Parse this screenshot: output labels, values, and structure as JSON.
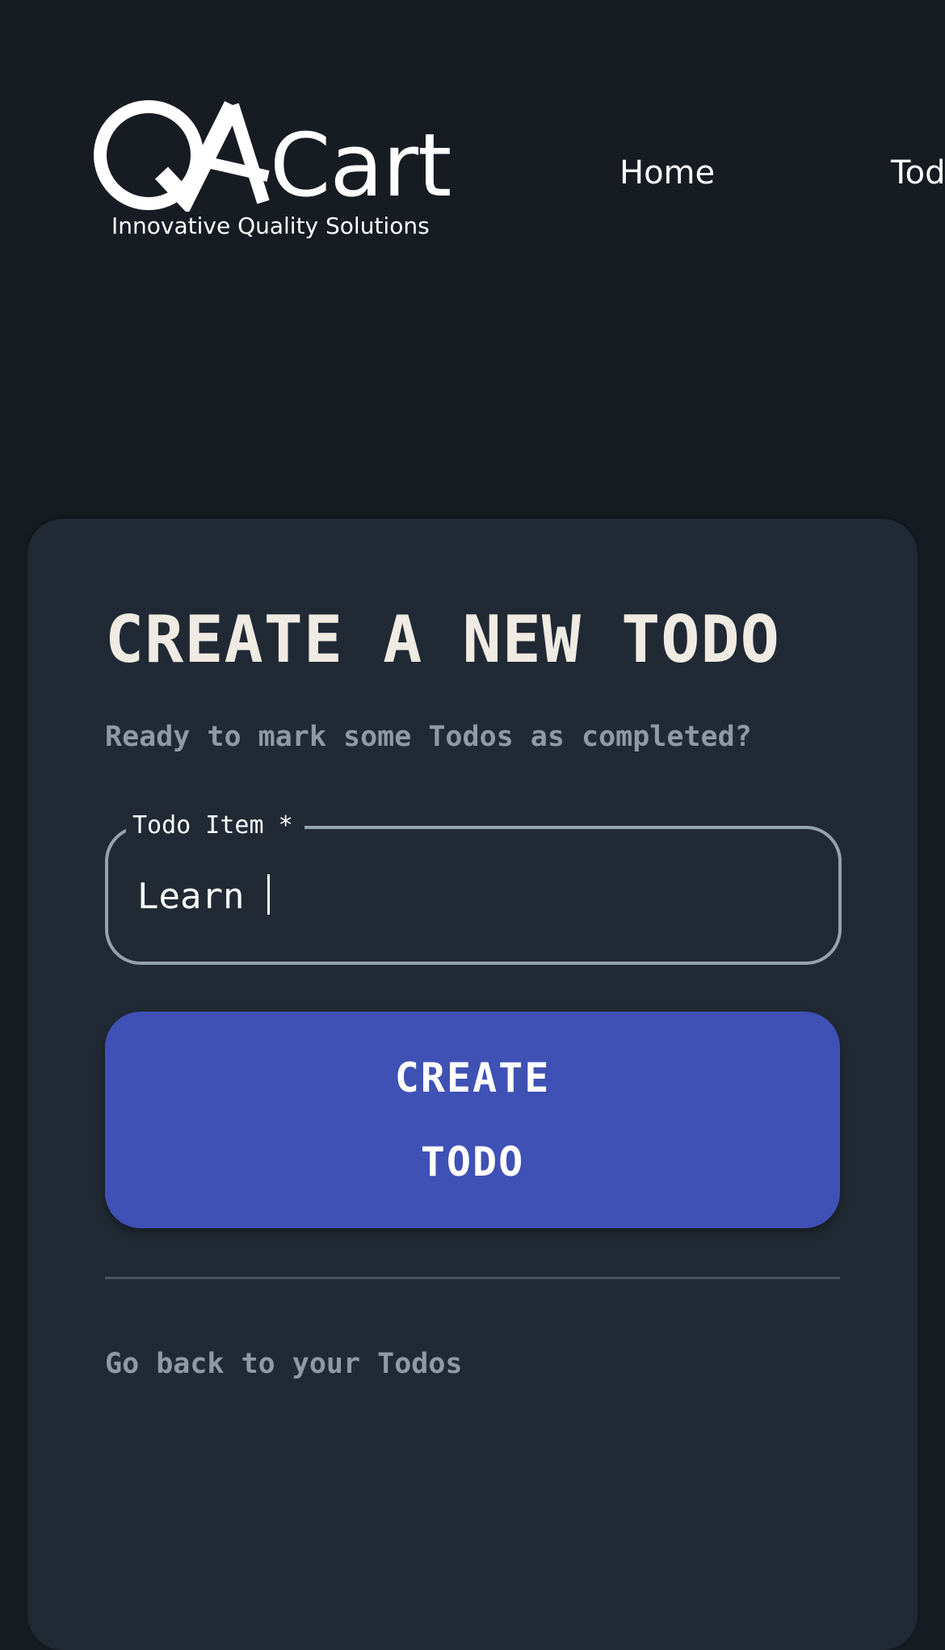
{
  "header": {
    "logo": {
      "brand_mark": "QA",
      "brand_word": "Cart",
      "tagline": "Innovative Quality Solutions"
    },
    "nav": {
      "home_label": "Home",
      "todos_label": "Todos"
    }
  },
  "card": {
    "title": "CREATE A NEW TODO",
    "subtitle": "Ready to mark some Todos as completed?",
    "field": {
      "label": "Todo Item *",
      "value": "Learn "
    },
    "button": {
      "line1": "CREATE",
      "line2": "TODO"
    },
    "back_link": "Go back to your Todos"
  },
  "colors": {
    "page_background": "#171c23",
    "card_background": "#212a34",
    "accent": "#3f51b5",
    "muted_text": "#8e9aa6",
    "title_text": "#efebe3"
  }
}
